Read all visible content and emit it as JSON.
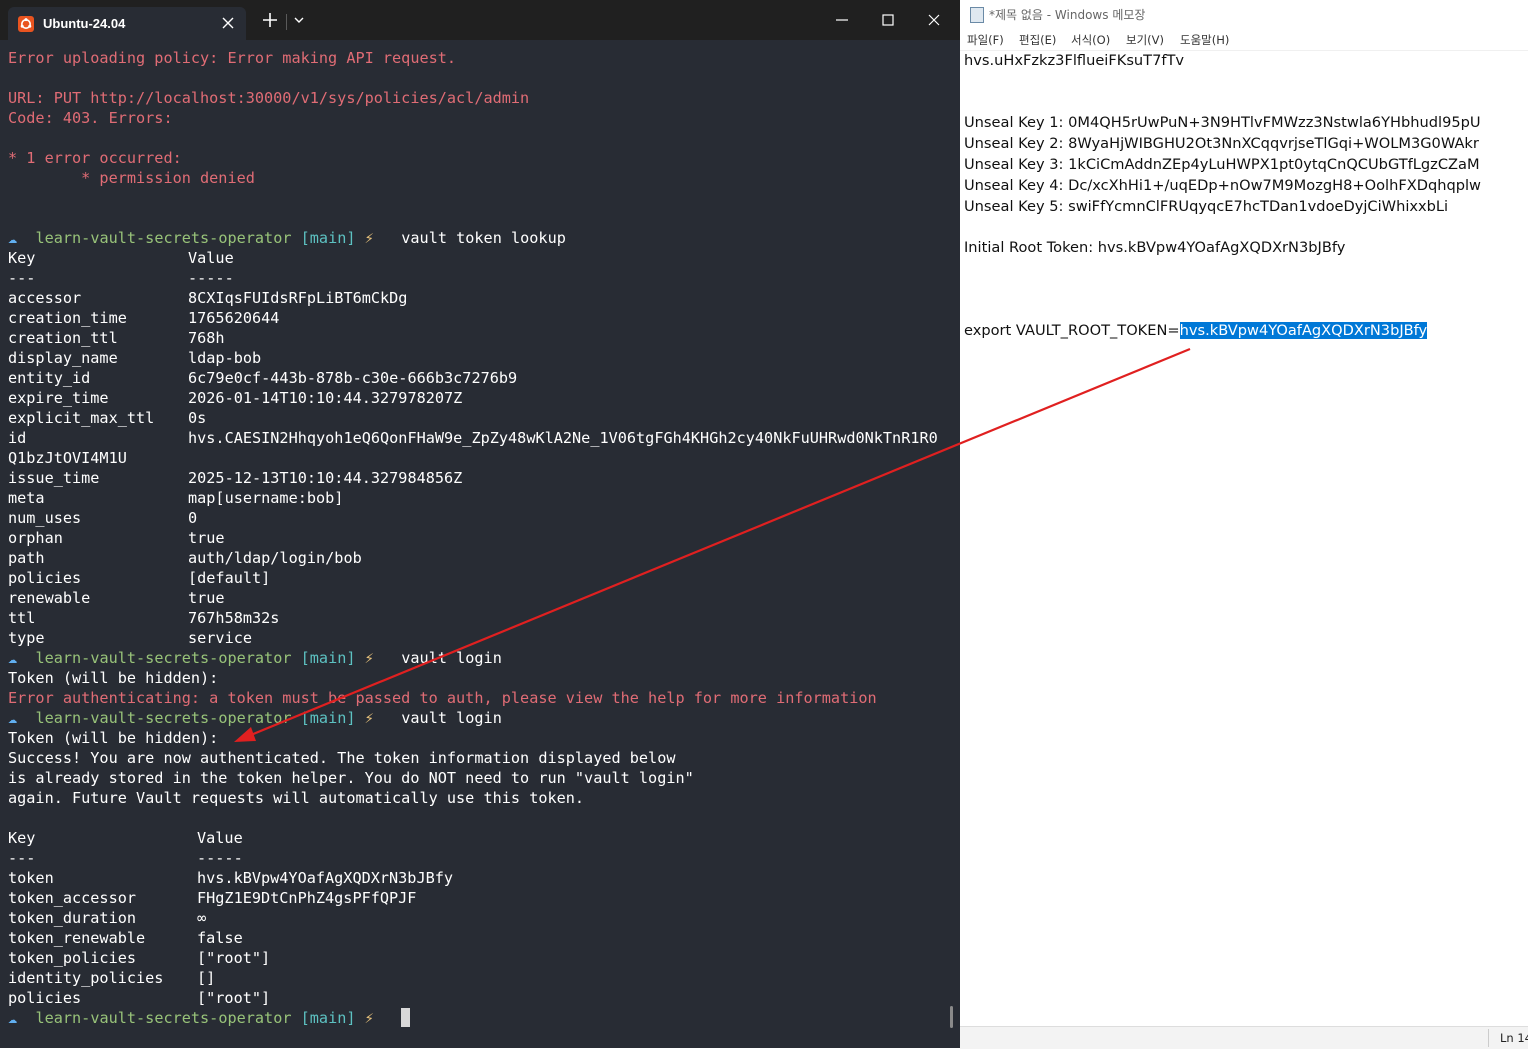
{
  "terminal": {
    "tab_title": "Ubuntu-24.04",
    "tab_icon": "ubuntu-logo-icon",
    "background_color": "#282c34",
    "error_color": "#e06c75",
    "lines": [
      {
        "type": "error",
        "text": "Error uploading policy: Error making API request."
      },
      {
        "type": "blank"
      },
      {
        "type": "error",
        "text": "URL: PUT http://localhost:30000/v1/sys/policies/acl/admin"
      },
      {
        "type": "error",
        "text": "Code: 403. Errors:"
      },
      {
        "type": "blank"
      },
      {
        "type": "error",
        "text": "* 1 error occurred:"
      },
      {
        "type": "error",
        "text": "        * permission denied"
      },
      {
        "type": "blank"
      },
      {
        "type": "blank"
      },
      {
        "type": "prompt",
        "cmd": "vault token lookup"
      },
      {
        "type": "kv",
        "key": "Key",
        "value": "Value"
      },
      {
        "type": "kv",
        "key": "---",
        "value": "-----"
      },
      {
        "type": "kv",
        "key": "accessor",
        "value": "8CXIqsFUIdsRFpLiBT6mCkDg"
      },
      {
        "type": "kv",
        "key": "creation_time",
        "value": "1765620644"
      },
      {
        "type": "kv",
        "key": "creation_ttl",
        "value": "768h"
      },
      {
        "type": "kv",
        "key": "display_name",
        "value": "ldap-bob"
      },
      {
        "type": "kv",
        "key": "entity_id",
        "value": "6c79e0cf-443b-878b-c30e-666b3c7276b9"
      },
      {
        "type": "kv",
        "key": "expire_time",
        "value": "2026-01-14T10:10:44.327978207Z"
      },
      {
        "type": "kv",
        "key": "explicit_max_ttl",
        "value": "0s"
      },
      {
        "type": "kv",
        "key": "id",
        "value": "hvs.CAESIN2Hhqyoh1eQ6QonFHaW9e_ZpZy48wKlA2Ne_1V06tgFGh4KHGh2cy40NkFuUHRwd0NkTnR1R0"
      },
      {
        "type": "text",
        "text": "Q1bzJtOVI4M1U"
      },
      {
        "type": "kv",
        "key": "issue_time",
        "value": "2025-12-13T10:10:44.327984856Z"
      },
      {
        "type": "kv",
        "key": "meta",
        "value": "map[username:bob]"
      },
      {
        "type": "kv",
        "key": "num_uses",
        "value": "0"
      },
      {
        "type": "kv",
        "key": "orphan",
        "value": "true"
      },
      {
        "type": "kv",
        "key": "path",
        "value": "auth/ldap/login/bob"
      },
      {
        "type": "kv",
        "key": "policies",
        "value": "[default]"
      },
      {
        "type": "kv",
        "key": "renewable",
        "value": "true"
      },
      {
        "type": "kv",
        "key": "ttl",
        "value": "767h58m32s"
      },
      {
        "type": "kv",
        "key": "type",
        "value": "service"
      },
      {
        "type": "prompt",
        "cmd": "vault login"
      },
      {
        "type": "text",
        "text": "Token (will be hidden):"
      },
      {
        "type": "error",
        "text": "Error authenticating: a token must be passed to auth, please view the help for more information"
      },
      {
        "type": "prompt",
        "cmd": "vault login"
      },
      {
        "type": "text",
        "text": "Token (will be hidden):"
      },
      {
        "type": "text",
        "text": "Success! You are now authenticated. The token information displayed below"
      },
      {
        "type": "text",
        "text": "is already stored in the token helper. You do NOT need to run \"vault login\""
      },
      {
        "type": "text",
        "text": "again. Future Vault requests will automatically use this token."
      },
      {
        "type": "blank"
      },
      {
        "type": "kv2",
        "key": "Key",
        "value": "Value"
      },
      {
        "type": "kv2",
        "key": "---",
        "value": "-----"
      },
      {
        "type": "kv2",
        "key": "token",
        "value": "hvs.kBVpw4YOafAgXQDXrN3bJBfy"
      },
      {
        "type": "kv2",
        "key": "token_accessor",
        "value": "FHgZ1E9DtCnPhZ4gsPFfQPJF"
      },
      {
        "type": "kv2",
        "key": "token_duration",
        "value": "∞"
      },
      {
        "type": "kv2",
        "key": "token_renewable",
        "value": "false"
      },
      {
        "type": "kv2",
        "key": "token_policies",
        "value": "[\"root\"]"
      },
      {
        "type": "kv2",
        "key": "identity_policies",
        "value": "[]"
      },
      {
        "type": "kv2",
        "key": "policies",
        "value": "[\"root\"]"
      },
      {
        "type": "prompt",
        "cmd": "",
        "cursor": true
      }
    ]
  },
  "prompt": {
    "arrow": "☁",
    "dir": "learn-vault-secrets-operator",
    "branch": "[main]",
    "bolt": "⚡"
  },
  "notepad": {
    "title": "*제목 없음 - Windows 메모장",
    "icon": "notepad-icon",
    "menu": [
      "파일(F)",
      "편집(E)",
      "서식(O)",
      "보기(V)",
      "도움말(H)"
    ],
    "lines": [
      {
        "text": "hvs.uHxFzkz3FlflueiFKsuT7fTv"
      },
      {
        "text": ""
      },
      {
        "text": ""
      },
      {
        "text": "Unseal Key 1: 0M4QH5rUwPuN+3N9HTlvFMWzz3Nstwla6YHbhudl95pU"
      },
      {
        "text": "Unseal Key 2: 8WyaHjWIBGHU2Ot3NnXCqqvrjseTlGqi+WOLM3G0WAkr"
      },
      {
        "text": "Unseal Key 3: 1kCiCmAddnZEp4yLuHWPX1pt0ytqCnQCUbGTfLgzCZaM"
      },
      {
        "text": "Unseal Key 4: Dc/xcXhHi1+/uqEDp+nOw7M9MozgH8+OolhFXDqhqplw"
      },
      {
        "text": "Unseal Key 5: swiFfYcmnClFRUqyqcE7hcTDan1vdoeDyjCiWhixxbLi"
      },
      {
        "text": ""
      },
      {
        "text": "Initial Root Token: hvs.kBVpw4YOafAgXQDXrN3bJBfy"
      },
      {
        "text": ""
      },
      {
        "text": ""
      },
      {
        "text": ""
      },
      {
        "text": "export VAULT_ROOT_TOKEN=",
        "selected": "hvs.kBVpw4YOafAgXQDXrN3bJBfy"
      }
    ],
    "status": "Ln 14",
    "selection_color": "#0078d7"
  },
  "annotation": {
    "type": "red-arrow",
    "color": "#e02020"
  }
}
